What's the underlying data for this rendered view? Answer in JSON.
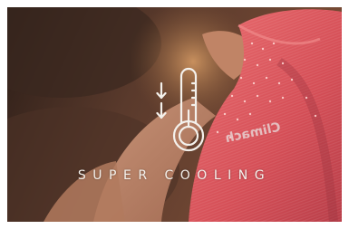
{
  "photo": {
    "subject": "athlete-back-wearing-red-striped-top",
    "garment_color": "#e0545a",
    "background_color": "#2e2019"
  },
  "overlay": {
    "icon": "thermometer-down-icon",
    "caption": "SUPER COOLING",
    "brand_mark": "Climach"
  }
}
